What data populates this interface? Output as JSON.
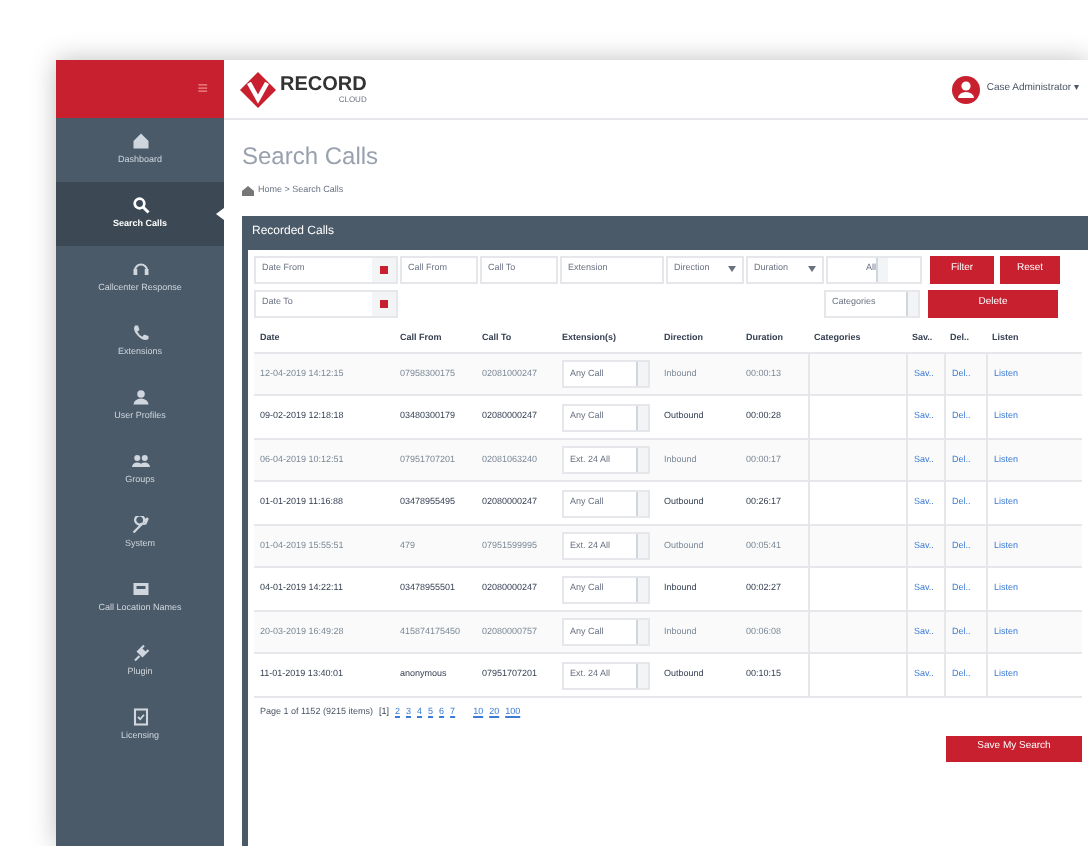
{
  "header": {
    "logo": {
      "name": "RECORD",
      "sub": "CLOUD"
    },
    "user": "Case Administrator ▾"
  },
  "sidebar": {
    "menu_glyph": "≡",
    "items": [
      {
        "label": "Dashboard",
        "selected": false
      },
      {
        "label": "Search Calls",
        "selected": true
      },
      {
        "label": "Callcenter Response",
        "selected": false
      },
      {
        "label": "Extensions",
        "selected": false
      },
      {
        "label": "User Profiles",
        "selected": false
      },
      {
        "label": "Groups",
        "selected": false
      },
      {
        "label": "System",
        "selected": false
      },
      {
        "label": "Call Location Names",
        "selected": false
      },
      {
        "label": "Plugin",
        "selected": false
      },
      {
        "label": "Licensing",
        "selected": false
      }
    ]
  },
  "page_title": "Search Calls",
  "breadcrumb": "Home > Search Calls",
  "panel": {
    "title": "Recorded Calls",
    "filters": {
      "date_from": "Date From",
      "date_to": "Date To",
      "call_from": "Call From",
      "call_to": "Call To",
      "extension": "Extension",
      "direction": "Direction",
      "duration": "Duration",
      "all": "All",
      "categories": "Categories"
    },
    "buttons": {
      "filter": "Filter",
      "reset": "Reset",
      "delete": "Delete",
      "save_search": "Save My Search"
    },
    "table": {
      "columns": [
        "Date",
        "Call From",
        "Call To",
        "Extension(s)",
        "Direction",
        "Duration",
        "Categories",
        "Sav..",
        "Del..",
        "Listen"
      ],
      "rows": [
        {
          "cells": [
            "12-04-2019 14:12:15",
            "07958300175",
            "02081000247",
            "Any Call",
            "Inbound",
            "00:00:13",
            "",
            "Sav..",
            "Del..",
            "Listen"
          ]
        },
        {
          "cells": [
            "09-02-2019 12:18:18",
            "03480300179",
            "02080000247",
            "Any Call",
            "Outbound",
            "00:00:28",
            "",
            "Sav..",
            "Del..",
            "Listen"
          ]
        },
        {
          "cells": [
            "06-04-2019 10:12:51",
            "07951707201",
            "02081063240",
            "Ext. 24 All",
            "Inbound",
            "00:00:17",
            "",
            "Sav..",
            "Del..",
            "Listen"
          ]
        },
        {
          "cells": [
            "01-01-2019 11:16:88",
            "03478955495",
            "02080000247",
            "Any Call",
            "Outbound",
            "00:26:17",
            "",
            "Sav..",
            "Del..",
            "Listen"
          ]
        },
        {
          "cells": [
            "01-04-2019 15:55:51",
            "479",
            "07951599995",
            "Ext. 24 All",
            "Outbound",
            "00:05:41",
            "",
            "Sav..",
            "Del..",
            "Listen"
          ]
        },
        {
          "cells": [
            "04-01-2019 14:22:11",
            "03478955501",
            "02080000247",
            "Any Call",
            "Inbound",
            "00:02:27",
            "",
            "Sav..",
            "Del..",
            "Listen"
          ]
        },
        {
          "cells": [
            "20-03-2019 16:49:28",
            "415874175450",
            "02080000757",
            "Any Call",
            "Inbound",
            "00:06:08",
            "",
            "Sav..",
            "Del..",
            "Listen"
          ]
        },
        {
          "cells": [
            "11-01-2019 13:40:01",
            "anonymous",
            "07951707201",
            "Ext. 24 All",
            "Outbound",
            "00:10:15",
            "",
            "Sav..",
            "Del..",
            "Listen"
          ]
        }
      ]
    },
    "pager": {
      "summary": "Page 1 of 1152 (9215 items)",
      "pages": [
        "[1]",
        "2",
        "3",
        "4",
        "5",
        "6",
        "7"
      ],
      "sizes": [
        "10",
        "20",
        "100"
      ]
    }
  }
}
